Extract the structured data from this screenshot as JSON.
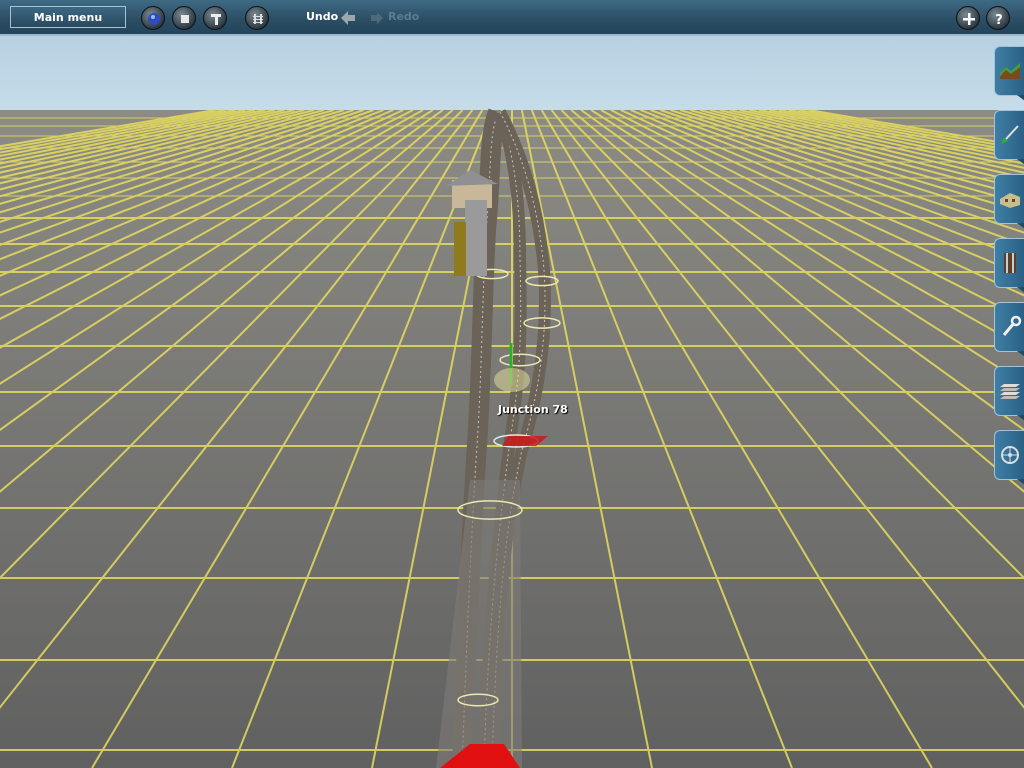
{
  "toolbar": {
    "main_menu_label": "Main menu",
    "buttons": [
      "view-mode",
      "stop",
      "info",
      "track-layout"
    ],
    "undo_label": "Undo",
    "redo_label": "Redo",
    "right_buttons": [
      "add",
      "help"
    ]
  },
  "viewport": {
    "junction_label": "Junction 78",
    "sky_color": "#b9d3e3",
    "ground_color": "#6a6a66",
    "grid_color": "#e9df6a"
  },
  "palette": {
    "tools": [
      "terrain-tool",
      "paint-tool",
      "objects-tool",
      "track-tool",
      "trackside-tool",
      "layers-tool",
      "settings-tool"
    ]
  }
}
